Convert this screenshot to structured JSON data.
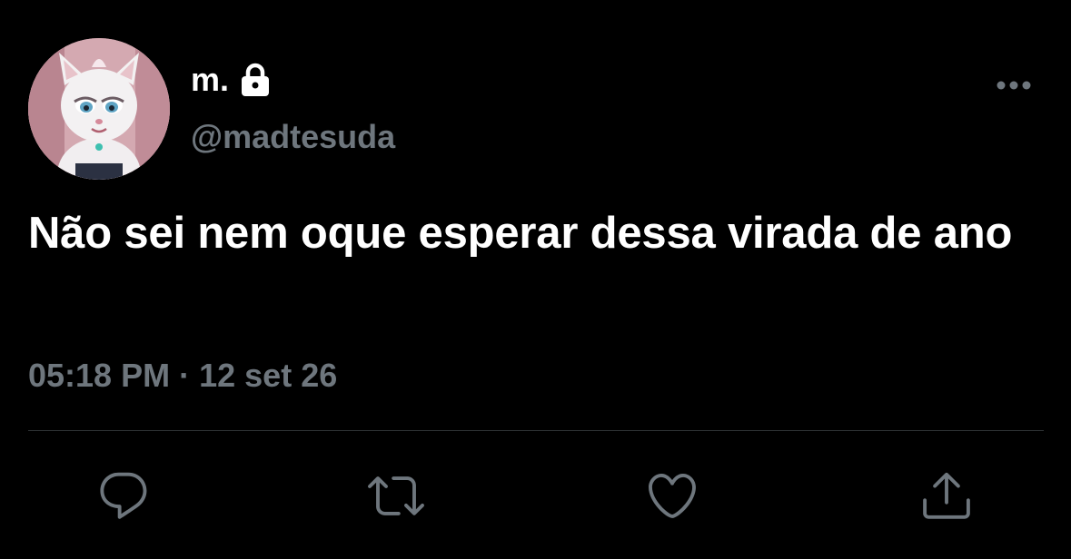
{
  "user": {
    "display_name": "m.",
    "handle": "@madtesuda",
    "protected": true,
    "avatar": "avatar-image"
  },
  "tweet": {
    "text": "Não sei nem oque esperar dessa virada de ano",
    "time": "05:18 PM",
    "separator": "·",
    "date": "12 set 26"
  },
  "icons": {
    "lock": "lock-icon",
    "more": "more-icon",
    "reply": "reply-icon",
    "retweet": "retweet-icon",
    "like": "like-icon",
    "share": "share-icon"
  },
  "colors": {
    "background": "#000000",
    "text": "#ffffff",
    "secondary": "#6e767d",
    "divider": "#2f3336"
  }
}
